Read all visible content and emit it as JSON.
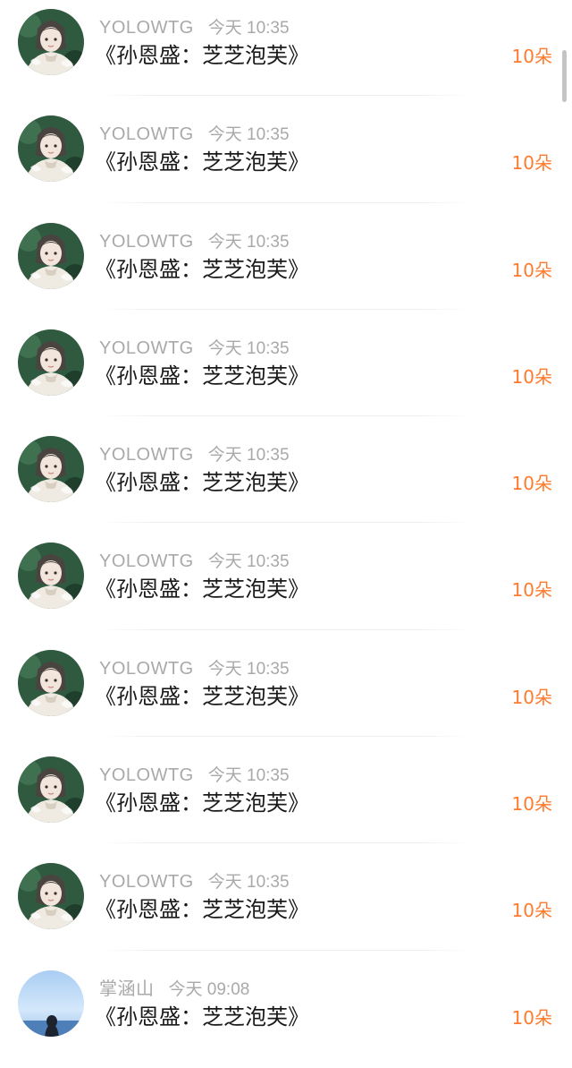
{
  "messages": [
    {
      "sender": "YOLOWTG",
      "time": "今天 10:35",
      "content": "《孙恩盛：芝芝泡芙》",
      "count": "10朵",
      "avatar_icon": "avatar-illustrated-girl"
    },
    {
      "sender": "YOLOWTG",
      "time": "今天 10:35",
      "content": "《孙恩盛：芝芝泡芙》",
      "count": "10朵",
      "avatar_icon": "avatar-illustrated-girl"
    },
    {
      "sender": "YOLOWTG",
      "time": "今天 10:35",
      "content": "《孙恩盛：芝芝泡芙》",
      "count": "10朵",
      "avatar_icon": "avatar-illustrated-girl"
    },
    {
      "sender": "YOLOWTG",
      "time": "今天 10:35",
      "content": "《孙恩盛：芝芝泡芙》",
      "count": "10朵",
      "avatar_icon": "avatar-illustrated-girl"
    },
    {
      "sender": "YOLOWTG",
      "time": "今天 10:35",
      "content": "《孙恩盛：芝芝泡芙》",
      "count": "10朵",
      "avatar_icon": "avatar-illustrated-girl"
    },
    {
      "sender": "YOLOWTG",
      "time": "今天 10:35",
      "content": "《孙恩盛：芝芝泡芙》",
      "count": "10朵",
      "avatar_icon": "avatar-illustrated-girl"
    },
    {
      "sender": "YOLOWTG",
      "time": "今天 10:35",
      "content": "《孙恩盛：芝芝泡芙》",
      "count": "10朵",
      "avatar_icon": "avatar-illustrated-girl"
    },
    {
      "sender": "YOLOWTG",
      "time": "今天 10:35",
      "content": "《孙恩盛：芝芝泡芙》",
      "count": "10朵",
      "avatar_icon": "avatar-illustrated-girl"
    },
    {
      "sender": "YOLOWTG",
      "time": "今天 10:35",
      "content": "《孙恩盛：芝芝泡芙》",
      "count": "10朵",
      "avatar_icon": "avatar-illustrated-girl"
    },
    {
      "sender": "掌涵山",
      "time": "今天 09:08",
      "content": "《孙恩盛：芝芝泡芙》",
      "count": "10朵",
      "avatar_icon": "avatar-sky-silhouette"
    }
  ],
  "colors": {
    "accent": "#ff7a2c",
    "meta_text": "#a9a9a9",
    "body_text": "#1a1a1a",
    "divider": "#eeeeee"
  }
}
